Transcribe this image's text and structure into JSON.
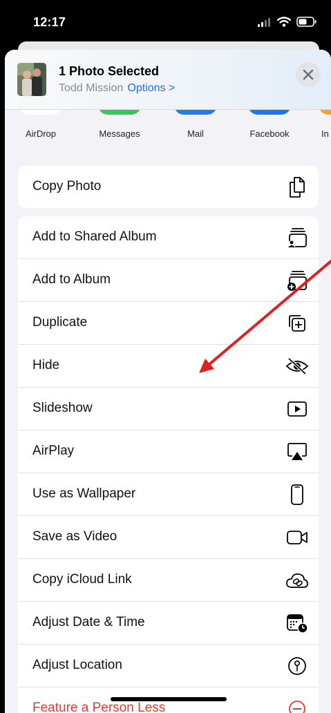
{
  "status": {
    "time": "12:17"
  },
  "header": {
    "title": "1 Photo Selected",
    "owner": "Todd Mission",
    "options": "Options",
    "options_chevron": ">"
  },
  "apps": [
    {
      "label": "AirDrop",
      "icon": "airdrop-icon",
      "color": "#1e90ff"
    },
    {
      "label": "Messages",
      "icon": "messages-icon",
      "color": "#34c759"
    },
    {
      "label": "Mail",
      "icon": "mail-icon",
      "color": "#1a8cff"
    },
    {
      "label": "Facebook",
      "icon": "facebook-icon",
      "color": "#1877f2"
    },
    {
      "label": "In",
      "icon": "app-icon",
      "color": "#f5a623"
    }
  ],
  "groups": [
    [
      {
        "label": "Copy Photo",
        "icon": "copy-icon"
      }
    ],
    [
      {
        "label": "Add to Shared Album",
        "icon": "shared-album-icon"
      },
      {
        "label": "Add to Album",
        "icon": "add-album-icon"
      },
      {
        "label": "Duplicate",
        "icon": "duplicate-icon"
      },
      {
        "label": "Hide",
        "icon": "hide-eye-icon"
      },
      {
        "label": "Slideshow",
        "icon": "slideshow-icon"
      },
      {
        "label": "AirPlay",
        "icon": "airplay-icon"
      },
      {
        "label": "Use as Wallpaper",
        "icon": "wallpaper-phone-icon"
      },
      {
        "label": "Save as Video",
        "icon": "video-camera-icon"
      },
      {
        "label": "Copy iCloud Link",
        "icon": "icloud-link-icon"
      },
      {
        "label": "Adjust Date & Time",
        "icon": "calendar-clock-icon"
      },
      {
        "label": "Adjust Location",
        "icon": "location-pin-icon"
      },
      {
        "label": "Feature a Person Less",
        "icon": "minus-circle-icon",
        "destructive": true
      }
    ]
  ],
  "colors": {
    "accent": "#1f6fde",
    "annotation_arrow": "#e02020",
    "destructive": "#e5392f"
  }
}
